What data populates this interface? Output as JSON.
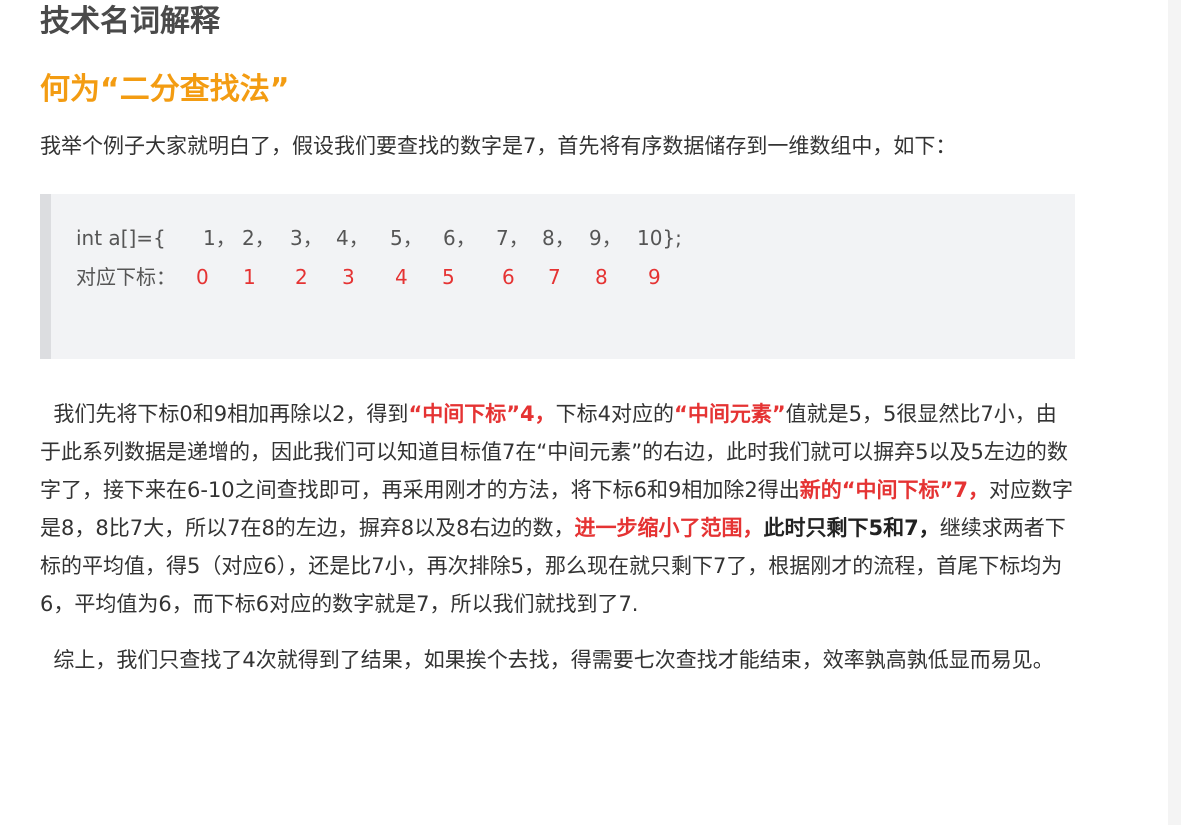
{
  "section_heading": "技术名词解释",
  "title": "何为“二分查找法”",
  "intro": "我举个例子大家就明白了，假设我们要查找的数字是7，首先将有序数据储存到一维数组中，如下：",
  "code": {
    "array_line": [
      "int a[]={",
      "1，",
      "2，",
      "3，",
      "4，",
      "5，",
      "6，",
      "7，",
      "8，",
      "9，",
      "10};"
    ],
    "index_label": "对应下标：",
    "indices": [
      "0",
      "1",
      "2",
      "3",
      "4",
      "5",
      "6",
      "7",
      "8",
      "9"
    ]
  },
  "explanation": {
    "p1": "  我们先将下标0和9相加再除以2，得到",
    "r1": "“中间下标”4，",
    "p2": "下标4对应的",
    "r2": "“中间元素”",
    "p3": "值就是5，5很显然比7小，由于此系列数据是递增的，因此我们可以知道目标值7在“中间元素”的右边，此时我们就可以摒弃5以及5左边的数字了，接下来在6-10之间查找即可，再采用刚才的方法，将下标6和9相加除2得出",
    "r3": "新的“中间下标”7，",
    "p4": "对应数字是8，8比7大，所以7在8的左边，摒弃8以及8右边的数，",
    "r4": "进一步缩小了范围，",
    "b1": "此时只剩下5和7，",
    "p5": "继续求两者下标的平均值，得5（对应6），还是比7小，再次排除5，那么现在就只剩下7了，根据刚才的流程，首尾下标均为6，平均值为6，而下标6对应的数字就是7，所以我们就找到了7."
  },
  "summary": "  综上，我们只查找了4次就得到了结果，如果挨个去找，得需要七次查找才能结束，效率孰高孰低显而易见。",
  "colors": {
    "title": "#f39c12",
    "emphasis_red": "#e53333",
    "code_background": "#f2f3f5"
  }
}
